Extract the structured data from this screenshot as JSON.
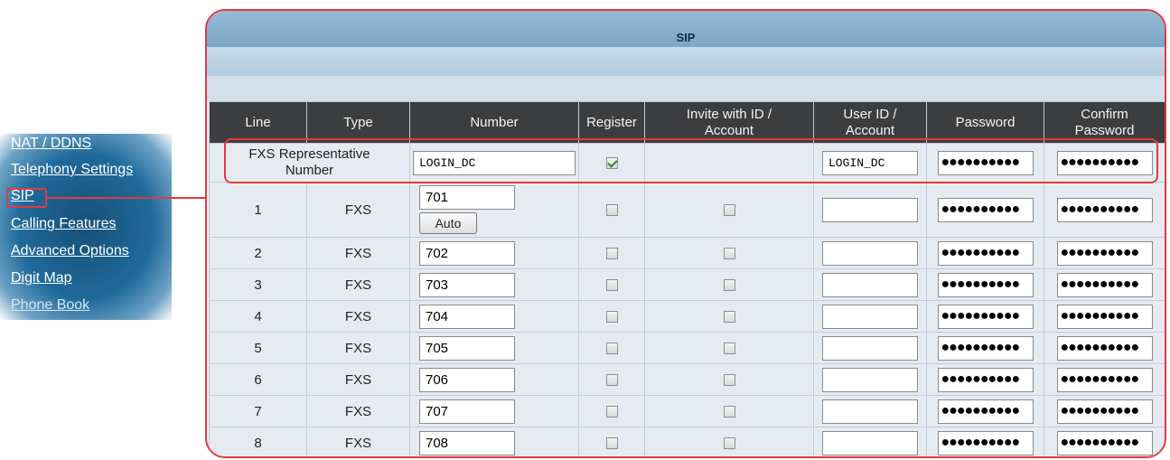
{
  "sidebar": {
    "items": [
      {
        "label": "NAT / DDNS"
      },
      {
        "label": "Telephony Settings"
      },
      {
        "label": "SIP"
      },
      {
        "label": "Calling Features"
      },
      {
        "label": "Advanced Options"
      },
      {
        "label": "Digit Map"
      },
      {
        "label": "Phone Book"
      }
    ]
  },
  "panel": {
    "title": "SIP",
    "columns": {
      "line": "Line",
      "type": "Type",
      "number": "Number",
      "register": "Register",
      "invite_1": "Invite with ID /",
      "invite_2": "Account",
      "userid_1": "User ID /",
      "userid_2": "Account",
      "password": "Password",
      "confirm_1": "Confirm",
      "confirm_2": "Password"
    },
    "representative": {
      "label_1": "FXS Representative",
      "label_2": "Number",
      "number": "LOGIN_DC",
      "register_checked": true,
      "user_id": "LOGIN_DC",
      "password": "●●●●●●●●●●",
      "confirm": "●●●●●●●●●●"
    },
    "auto_button": "Auto",
    "rows": [
      {
        "line": "1",
        "type": "FXS",
        "number": "701",
        "password": "●●●●●●●●●●",
        "confirm": "●●●●●●●●●●"
      },
      {
        "line": "2",
        "type": "FXS",
        "number": "702",
        "password": "●●●●●●●●●●",
        "confirm": "●●●●●●●●●●"
      },
      {
        "line": "3",
        "type": "FXS",
        "number": "703",
        "password": "●●●●●●●●●●",
        "confirm": "●●●●●●●●●●"
      },
      {
        "line": "4",
        "type": "FXS",
        "number": "704",
        "password": "●●●●●●●●●●",
        "confirm": "●●●●●●●●●●"
      },
      {
        "line": "5",
        "type": "FXS",
        "number": "705",
        "password": "●●●●●●●●●●",
        "confirm": "●●●●●●●●●●"
      },
      {
        "line": "6",
        "type": "FXS",
        "number": "706",
        "password": "●●●●●●●●●●",
        "confirm": "●●●●●●●●●●"
      },
      {
        "line": "7",
        "type": "FXS",
        "number": "707",
        "password": "●●●●●●●●●●",
        "confirm": "●●●●●●●●●●"
      },
      {
        "line": "8",
        "type": "FXS",
        "number": "708",
        "password": "●●●●●●●●●●",
        "confirm": "●●●●●●●●●●"
      }
    ]
  },
  "colors": {
    "highlight": "#e23b3b",
    "header_bg": "#3c3d3e",
    "sidebar_bg": "#1f6a9a"
  }
}
